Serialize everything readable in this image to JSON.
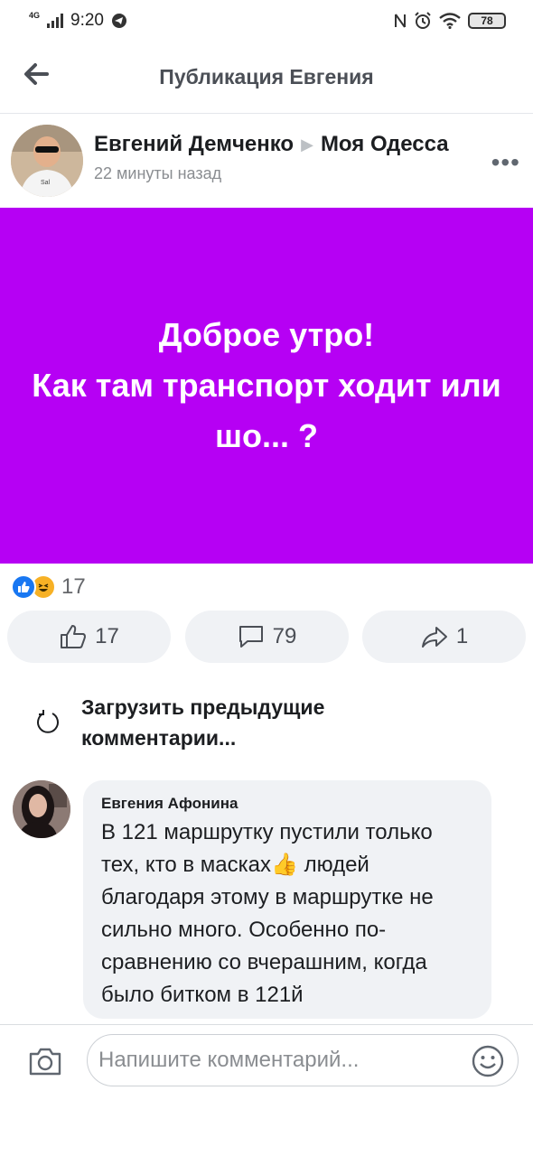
{
  "status": {
    "network": "4G",
    "time": "9:20",
    "battery": "78"
  },
  "header": {
    "title": "Публикация Евгения"
  },
  "post": {
    "author": "Евгений Демченко",
    "group": "Моя Одесса",
    "time": "22 минуты назад",
    "text_line1": "Доброе утро!",
    "text_line2": "Как там транспорт ходит или шо... ?",
    "banner_color": "#b600f4",
    "reactions_count": "17",
    "like_count": "17",
    "comment_count": "79",
    "share_count": "1"
  },
  "load_previous": "Загрузить предыдущие комментарии...",
  "comment": {
    "author": "Евгения Афонина",
    "text_before_emoji": "В 121 маршрутку пустили только тех, кто в масках",
    "emoji": "👍",
    "text_after_emoji": " людей благодаря этому в маршрутке не сильно много. Особенно по-сравнению со вчерашним, когда было битком в 121й"
  },
  "composer": {
    "placeholder": "Напишите комментарий..."
  },
  "icons": [
    "back-arrow-icon",
    "more-icon",
    "like-icon",
    "comment-icon",
    "share-icon",
    "refresh-icon",
    "camera-icon",
    "smile-icon"
  ]
}
